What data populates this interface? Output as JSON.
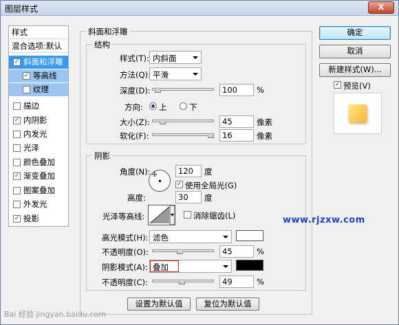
{
  "window": {
    "title": "图层样式",
    "close_label": "X"
  },
  "left_panel": {
    "header": "样式",
    "blend_options": "混合选项:默认",
    "items": [
      {
        "label": "斜面和浮雕",
        "checked": true,
        "selected": true
      },
      {
        "label": "等高线",
        "checked": true,
        "sub": true
      },
      {
        "label": "纹理",
        "checked": false,
        "sub": true
      },
      {
        "label": "描边",
        "checked": false
      },
      {
        "label": "内阴影",
        "checked": true
      },
      {
        "label": "内发光",
        "checked": false
      },
      {
        "label": "光泽",
        "checked": false
      },
      {
        "label": "颜色叠加",
        "checked": false
      },
      {
        "label": "渐变叠加",
        "checked": true
      },
      {
        "label": "图案叠加",
        "checked": false
      },
      {
        "label": "外发光",
        "checked": false
      },
      {
        "label": "投影",
        "checked": true
      }
    ]
  },
  "bevel": {
    "group_title": "斜面和浮雕",
    "structure": {
      "title": "结构",
      "style_label": "样式(T):",
      "style_value": "内斜面",
      "technique_label": "方法(Q):",
      "technique_value": "平滑",
      "depth_label": "深度(D):",
      "depth_value": "100",
      "depth_unit": "%",
      "depth_level": 0.1,
      "direction_label": "方向:",
      "direction_up": "上",
      "direction_down": "下",
      "size_label": "大小(Z):",
      "size_value": "45",
      "size_unit": "像素",
      "size_level": 0.18,
      "soften_label": "软化(F):",
      "soften_value": "16",
      "soften_unit": "像素",
      "soften_level": 0.96
    },
    "shading": {
      "title": "阴影",
      "angle_label": "角度(N):",
      "angle_value": "120",
      "angle_unit": "度",
      "global_light_label": "使用全局光(G)",
      "global_light_checked": true,
      "altitude_label": "高度:",
      "altitude_value": "30",
      "altitude_unit": "度",
      "gloss_contour_label": "光泽等高线:",
      "anti_alias_label": "消除锯齿(L)",
      "anti_alias_checked": false,
      "highlight_mode_label": "高光模式(H):",
      "highlight_mode_value": "滤色",
      "highlight_color": "#ffffff",
      "highlight_opacity_label": "不透明度(O):",
      "highlight_opacity_value": "45",
      "highlight_opacity_unit": "%",
      "highlight_opacity_level": 0.45,
      "shadow_mode_label": "阴影模式(A):",
      "shadow_mode_value": "叠加",
      "shadow_color": "#000000",
      "shadow_opacity_label": "不透明度(C):",
      "shadow_opacity_value": "49",
      "shadow_opacity_unit": "%",
      "shadow_opacity_level": 0.49
    },
    "make_default": "设置为默认值",
    "reset_default": "复位为默认值"
  },
  "buttons": {
    "ok": "确定",
    "cancel": "取消",
    "new_style": "新建样式(W)...",
    "preview_label": "预览(V)",
    "preview_checked": true
  },
  "watermark": "www.rjzxw.com",
  "baidu_watermark": "Bai 经验 jingyan.baidu.com"
}
